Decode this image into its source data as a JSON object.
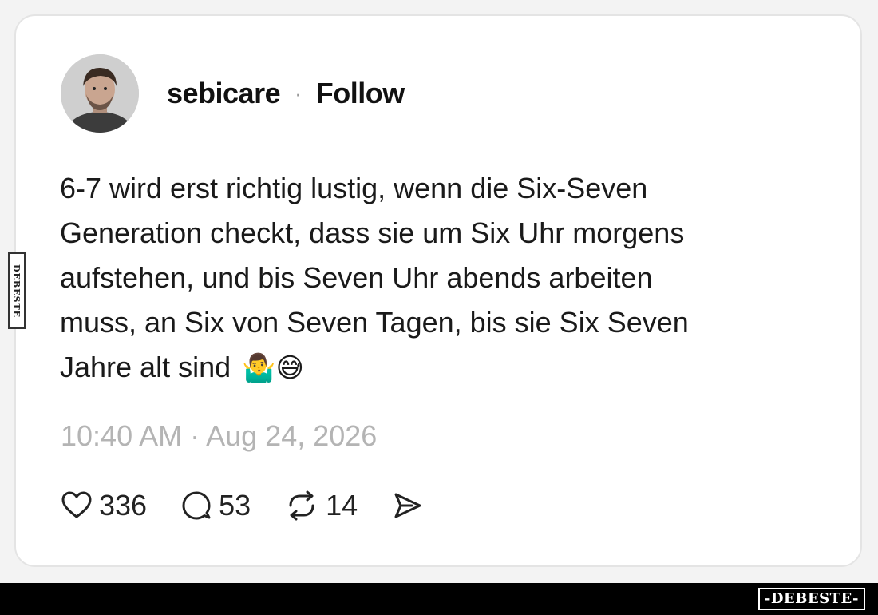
{
  "post": {
    "username": "sebicare",
    "separator": "·",
    "follow_label": "Follow",
    "text_lines": [
      "6-7 wird erst richtig lustig, wenn die Six-Seven",
      "Generation checkt, dass sie um Six Uhr morgens",
      "aufstehen, und bis Seven Uhr abends arbeiten",
      "muss, an Six von Seven Tagen, bis sie Six Seven",
      "Jahre alt sind"
    ],
    "emojis": "🤷‍♂️😅",
    "timestamp": "10:40 AM · Aug 24, 2026"
  },
  "actions": {
    "likes": "336",
    "comments": "53",
    "reposts": "14"
  },
  "icons": {
    "like": "heart-icon",
    "comment": "speech-bubble-icon",
    "repost": "repost-arrows-icon",
    "share": "send-arrow-icon"
  },
  "watermark": {
    "side_text": "DEBESTE",
    "logo_text": "-DEBESTE-"
  }
}
